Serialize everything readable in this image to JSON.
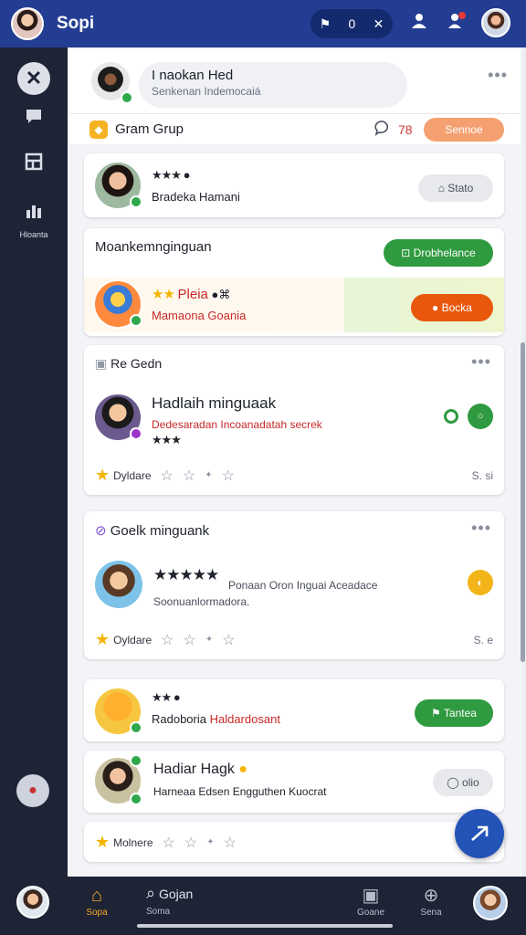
{
  "topbar": {
    "title": "Sopi",
    "pill_count": "0",
    "pill_close": "✕",
    "notification_count": "1"
  },
  "sidebar": {
    "chart_label": "Hloanta"
  },
  "header": {
    "name": "I naokan Hed",
    "subtitle": "Senkenan Indemocaiá"
  },
  "group": {
    "label": "Gram Grup",
    "count": "78",
    "button": "Sennoe"
  },
  "card1": {
    "name": "Bradeka Hamani",
    "button": "Stato"
  },
  "card2": {
    "title": "Moankemnginguan",
    "top_button": "Drobhelance",
    "name": "Pleia",
    "subtitle": "Mamaona Goania",
    "button": "Bocka"
  },
  "card3": {
    "section": "Re Gedn",
    "title": "Hadlaih minguaak",
    "subtitle": "Dedesaradan Incoanadatah secrek",
    "rate_label": "Dyldare",
    "rate_end": "S. si"
  },
  "card4": {
    "section": "Goelk minguank",
    "line1": "Ponaan Oron Inguai Aceadace",
    "line2": "Soonuanlormadora.",
    "rate_label": "Oyldare",
    "rate_end": "S. e"
  },
  "card5": {
    "name": "Radoboria",
    "name_red": "Haldardosant",
    "button": "Tantea"
  },
  "card6": {
    "name": "Hadiar Hagk",
    "subtitle": "Harneaa Edsen Engguthen Kuocrat",
    "button": "olio"
  },
  "card7": {
    "rate_label": "Molnere"
  },
  "bottomnav": {
    "home": "Sopa",
    "search": "Gojan",
    "search_sub": "Soma",
    "chat": "Goane",
    "explore": "Sena"
  }
}
